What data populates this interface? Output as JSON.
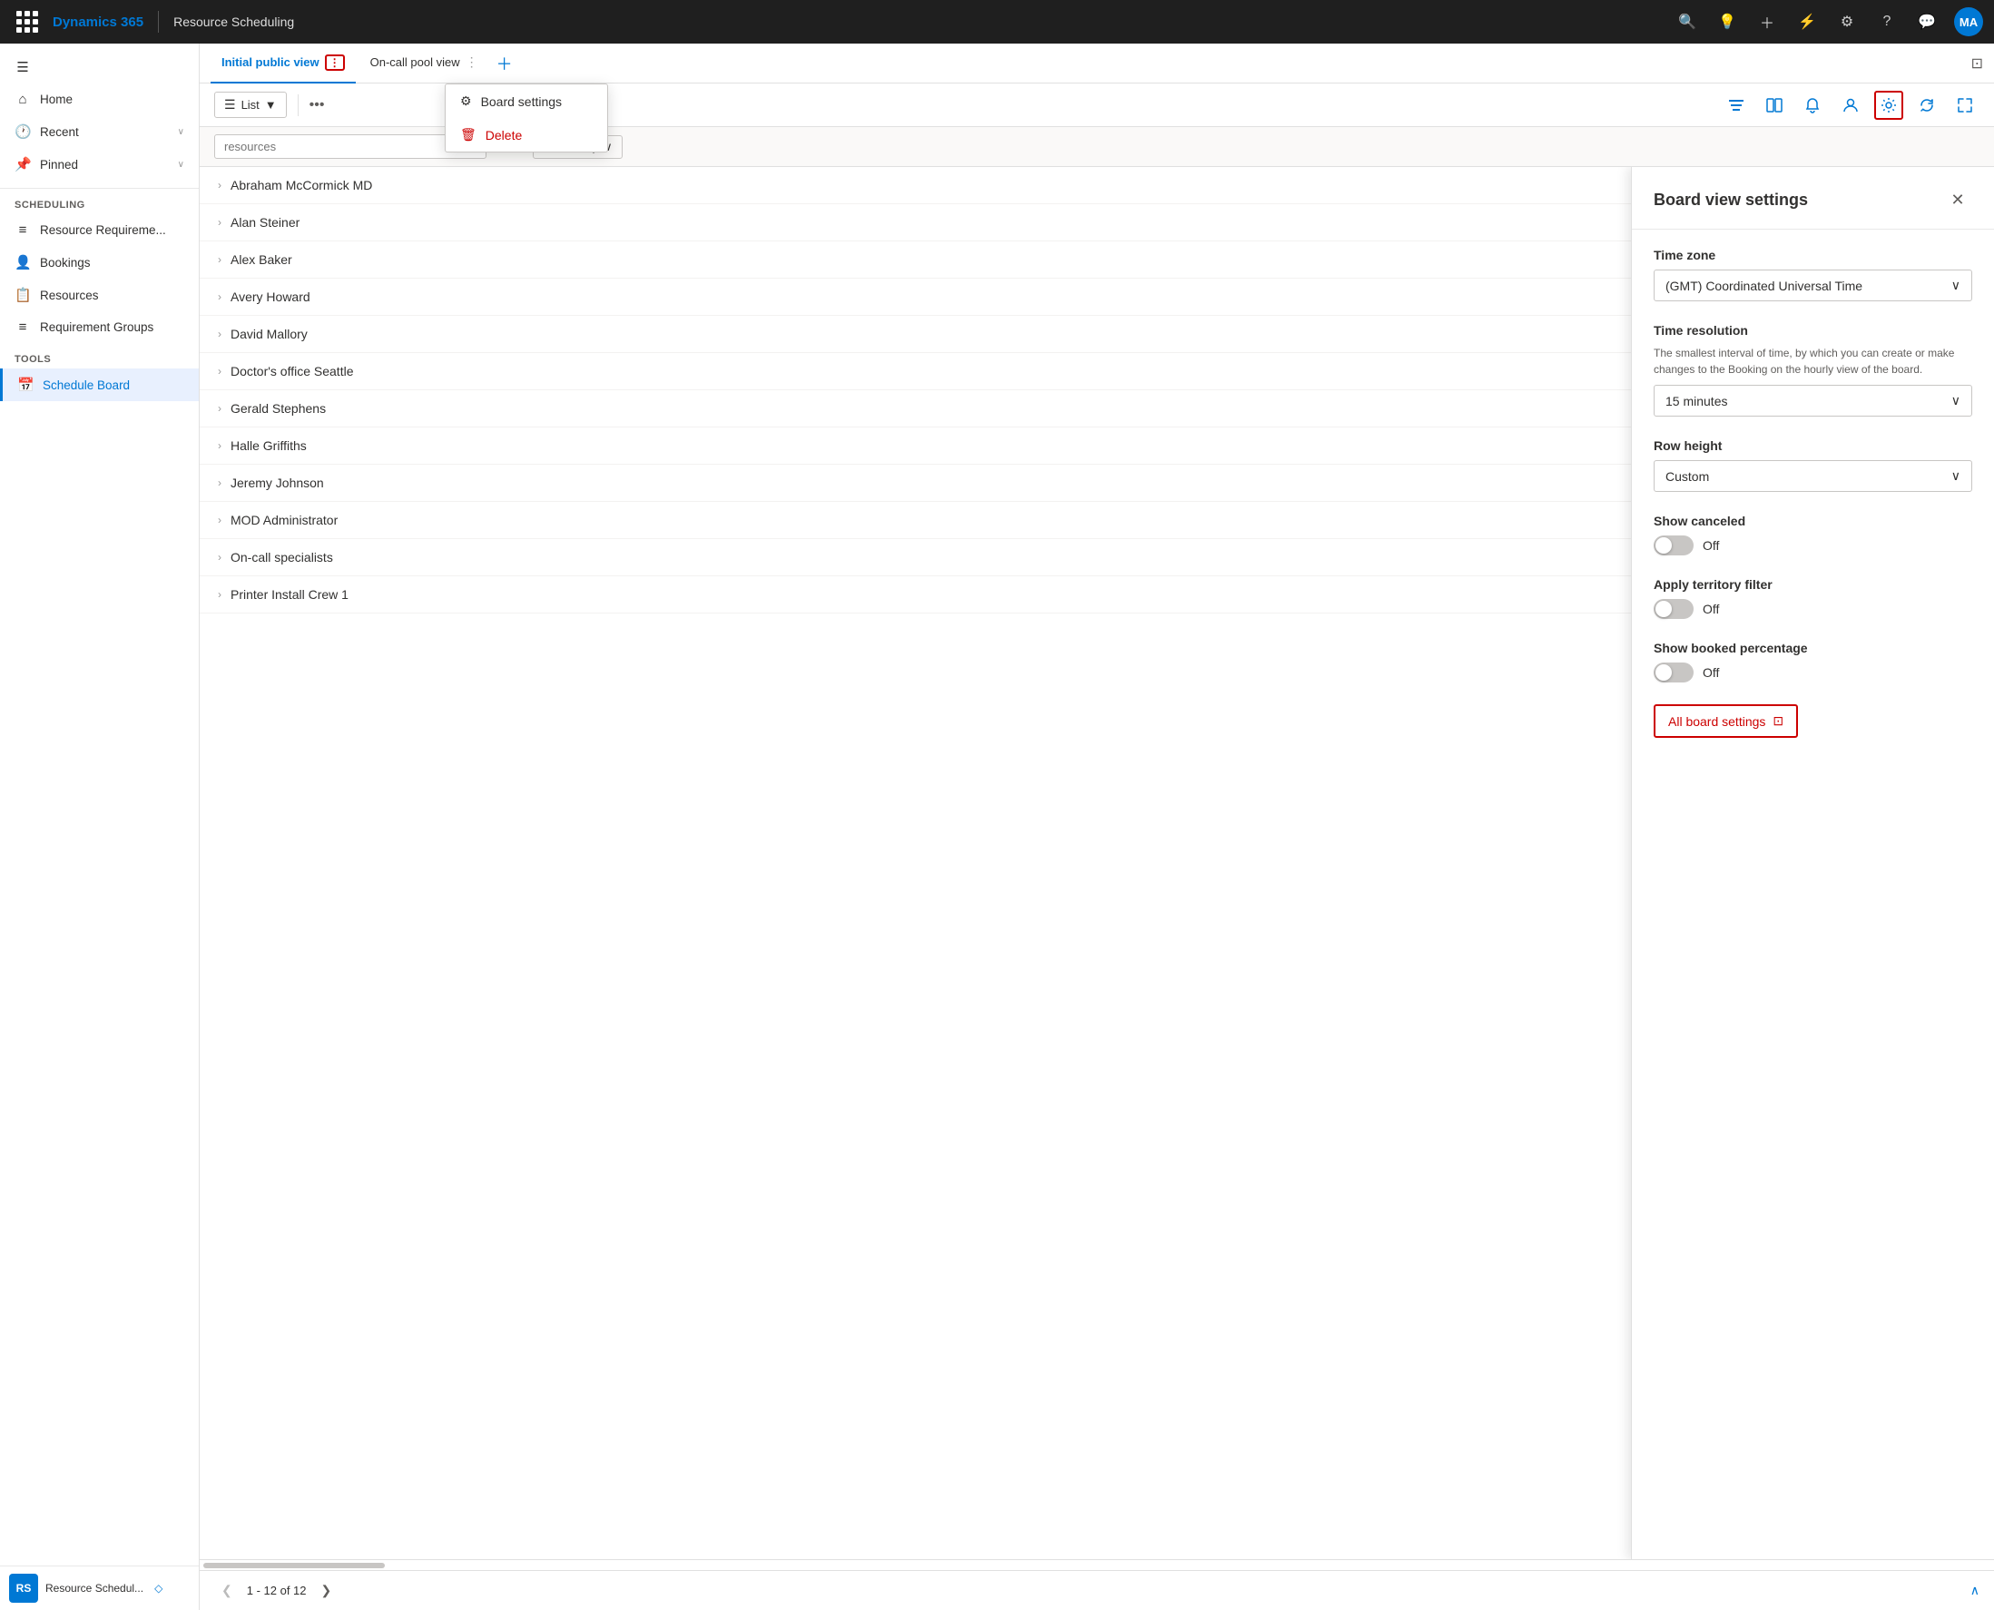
{
  "topNav": {
    "appName": "Dynamics 365",
    "moduleName": "Resource Scheduling",
    "avatarInitials": "MA",
    "icons": {
      "search": "🔍",
      "lightbulb": "💡",
      "add": "+",
      "filter": "⚡",
      "settings": "⚙",
      "help": "?",
      "chat": "💬"
    }
  },
  "sidebar": {
    "hamburger": "☰",
    "topItems": [
      {
        "label": "Home",
        "icon": "⌂"
      },
      {
        "label": "Recent",
        "icon": "🕐",
        "hasChevron": true
      },
      {
        "label": "Pinned",
        "icon": "📌",
        "hasChevron": true
      }
    ],
    "schedulingSection": "Scheduling",
    "schedulingItems": [
      {
        "label": "Resource Requireme...",
        "icon": "≡"
      },
      {
        "label": "Bookings",
        "icon": "👤"
      },
      {
        "label": "Resources",
        "icon": "📋"
      },
      {
        "label": "Requirement Groups",
        "icon": "≡"
      }
    ],
    "toolsSection": "Tools",
    "toolsItems": [
      {
        "label": "Schedule Board",
        "icon": "📅",
        "active": true
      }
    ],
    "footer": {
      "badge": "RS",
      "text": "Resource Schedul...",
      "diamondIcon": "◇"
    }
  },
  "tabs": [
    {
      "label": "Initial public view",
      "active": true,
      "hasMoreBorder": true
    },
    {
      "label": "On-call pool view",
      "active": false
    }
  ],
  "tabActions": {
    "add": "+",
    "screenIcon": "⊡"
  },
  "toolbar": {
    "viewLabel": "List",
    "viewIcon": "▼",
    "moreIcon": "•••",
    "rightIcons": [
      {
        "name": "filter-view-icon",
        "char": "⊟",
        "activeBorder": false
      },
      {
        "name": "columns-icon",
        "char": "⊞",
        "activeBorder": false
      },
      {
        "name": "notify-icon",
        "char": "🔔",
        "activeBorder": false
      },
      {
        "name": "person-icon",
        "char": "👤",
        "activeBorder": false
      },
      {
        "name": "settings-icon",
        "char": "⚙",
        "activeBorder": true
      },
      {
        "name": "refresh-icon",
        "char": "↻",
        "activeBorder": false
      },
      {
        "name": "expand-icon",
        "char": "⤢",
        "activeBorder": false
      }
    ]
  },
  "subToolbar": {
    "searchPlaceholder": "resources",
    "sortIcon": "⇅",
    "availabilityLabel": "Availability",
    "availChevron": "∨"
  },
  "resources": [
    {
      "name": "Abraham McCormick MD"
    },
    {
      "name": "Alan Steiner"
    },
    {
      "name": "Alex Baker"
    },
    {
      "name": "Avery Howard"
    },
    {
      "name": "David Mallory"
    },
    {
      "name": "Doctor's office Seattle"
    },
    {
      "name": "Gerald Stephens"
    },
    {
      "name": "Halle Griffiths"
    },
    {
      "name": "Jeremy Johnson"
    },
    {
      "name": "MOD Administrator"
    },
    {
      "name": "On-call specialists"
    },
    {
      "name": "Printer Install Crew 1"
    }
  ],
  "pagination": {
    "prevIcon": "❮",
    "nextIcon": "❯",
    "text": "1 - 12 of 12",
    "collapseIcon": "∧"
  },
  "contextMenu": {
    "items": [
      {
        "label": "Board settings",
        "icon": "⚙",
        "danger": false
      },
      {
        "label": "Delete",
        "icon": "🗑",
        "danger": true
      }
    ]
  },
  "boardViewSettings": {
    "title": "Board view settings",
    "closeIcon": "✕",
    "fields": [
      {
        "name": "timezone",
        "label": "Time zone",
        "value": "(GMT) Coordinated Universal Time",
        "type": "select"
      },
      {
        "name": "time-resolution",
        "label": "Time resolution",
        "desc": "The smallest interval of time, by which you can create or make changes to the Booking on the hourly view of the board.",
        "value": "15 minutes",
        "type": "select"
      },
      {
        "name": "row-height",
        "label": "Row height",
        "value": "Custom",
        "type": "select"
      },
      {
        "name": "show-canceled",
        "label": "Show canceled",
        "toggleState": "off",
        "type": "toggle"
      },
      {
        "name": "apply-territory",
        "label": "Apply territory filter",
        "toggleState": "off",
        "type": "toggle"
      },
      {
        "name": "show-booked",
        "label": "Show booked percentage",
        "toggleState": "off",
        "type": "toggle"
      }
    ],
    "allSettingsLabel": "All board settings",
    "allSettingsIcon": "⊡"
  }
}
